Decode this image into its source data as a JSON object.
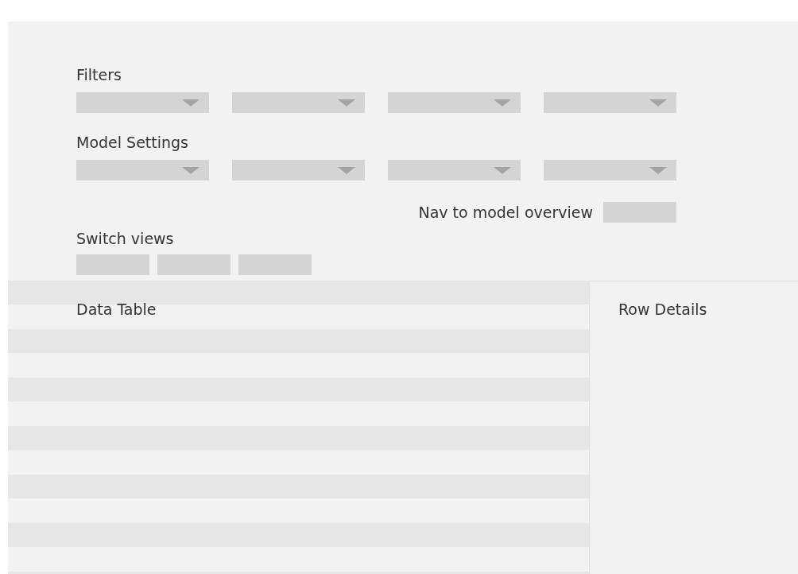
{
  "filters": {
    "label": "Filters",
    "controls": [
      {
        "kind": "dropdown"
      },
      {
        "kind": "dropdown"
      },
      {
        "kind": "dropdown"
      },
      {
        "kind": "dropdown"
      }
    ]
  },
  "model_settings": {
    "label": "Model Settings",
    "controls": [
      {
        "kind": "dropdown"
      },
      {
        "kind": "dropdown"
      },
      {
        "kind": "dropdown"
      },
      {
        "kind": "dropdown"
      }
    ]
  },
  "nav": {
    "label": "Nav to model overview",
    "controls": [
      {
        "kind": "button"
      }
    ]
  },
  "switch_views": {
    "label": "Switch views",
    "controls": [
      {
        "kind": "button"
      },
      {
        "kind": "button"
      },
      {
        "kind": "button"
      }
    ]
  },
  "data_table": {
    "title": "Data Table"
  },
  "row_details": {
    "title": "Row Details"
  }
}
